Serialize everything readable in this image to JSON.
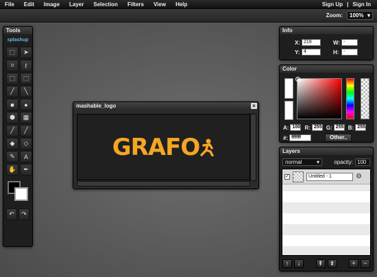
{
  "menu": {
    "items": [
      "File",
      "Edit",
      "Image",
      "Layer",
      "Selection",
      "Filters",
      "View",
      "Help"
    ],
    "sign_up": "Sign Up",
    "separator": "|",
    "sign_in": "Sign In"
  },
  "zoom": {
    "label": "Zoom:",
    "value": "100%"
  },
  "tools": {
    "title": "Tools",
    "brand": "splashup",
    "icons": [
      "marquee-rect-icon",
      "move-pointer-icon",
      "crop-icon",
      "lasso-icon",
      "select-all-icon",
      "deselect-icon",
      "pencil-icon",
      "line-icon",
      "rectangle-icon",
      "ellipse-icon",
      "polygon-icon",
      "gradient-icon",
      "brush-icon",
      "smudge-icon",
      "eraser-icon",
      "blur-icon",
      "eyedropper-icon",
      "text-icon",
      "hand-icon",
      "clone-icon"
    ],
    "glyphs": [
      "⬚",
      "➤",
      "⌗",
      "ℓ",
      "⬚",
      "⬚",
      "╱",
      "╲",
      "■",
      "●",
      "⬢",
      "▦",
      "╱",
      "╱",
      "◆",
      "◇",
      "✎",
      "A",
      "✋",
      "✒"
    ],
    "undo_glyph": "↶",
    "redo_glyph": "↷"
  },
  "canvas": {
    "title": "mashable_logo",
    "logo_text": "GRAFO",
    "close": "×"
  },
  "info": {
    "title": "Info",
    "x_label": "X:",
    "x_value": "219",
    "y_label": "Y:",
    "y_value": "4",
    "w_label": "W:",
    "w_value": "-",
    "h_label": "H:",
    "h_value": "-"
  },
  "color": {
    "title": "Color",
    "a_label": "A:",
    "a_value": "100",
    "r_label": "R:",
    "r_value": "255",
    "g_label": "G:",
    "g_value": "255",
    "b_label": "B:",
    "b_value": "255",
    "hex_label": "#:",
    "hex_value": "ffffff",
    "other_button": "Other.."
  },
  "layers": {
    "title": "Layers",
    "blend_mode": "normal",
    "opacity_label": "opacity:",
    "opacity_value": "100",
    "items": [
      {
        "name": "Untitled - 1"
      }
    ],
    "buttons": [
      "↑",
      "↓",
      "⇞",
      "⇟",
      "+",
      "−"
    ]
  },
  "colors_accent": {
    "logo": "#f5a623",
    "panel": "#1e1e1e"
  }
}
